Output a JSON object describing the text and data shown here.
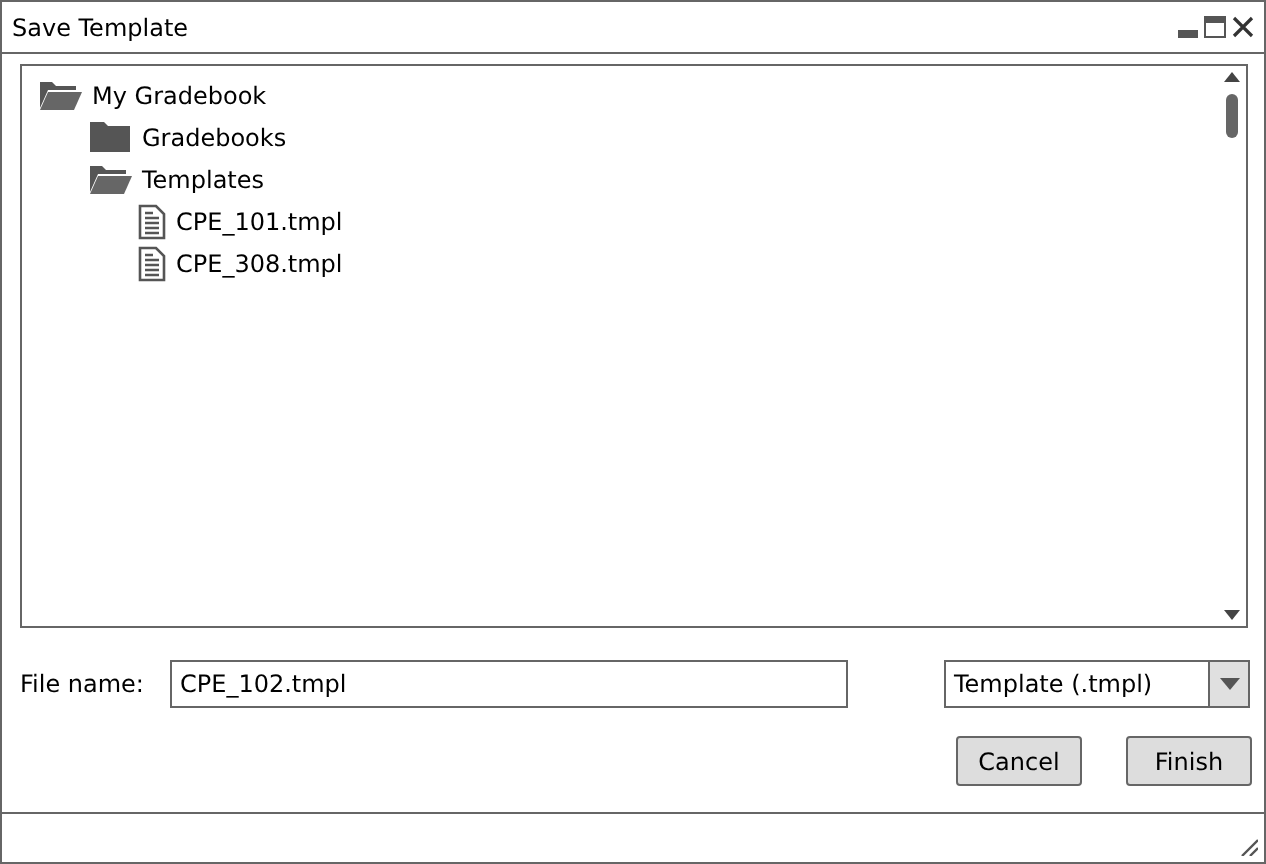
{
  "window": {
    "title": "Save Template"
  },
  "tree": [
    {
      "label": "My Gradebook",
      "kind": "folder",
      "expanded": true,
      "children": [
        {
          "label": "Gradebooks",
          "kind": "folder",
          "expanded": false
        },
        {
          "label": "Templates",
          "kind": "folder",
          "expanded": true,
          "children": [
            {
              "label": "CPE_101.tmpl",
              "kind": "file"
            },
            {
              "label": "CPE_308.tmpl",
              "kind": "file"
            }
          ]
        }
      ]
    }
  ],
  "file_name": {
    "label": "File name:",
    "value": "CPE_102.tmpl"
  },
  "file_type": {
    "value": "Template (.tmpl)"
  },
  "buttons": [
    "Cancel",
    "Finish"
  ]
}
